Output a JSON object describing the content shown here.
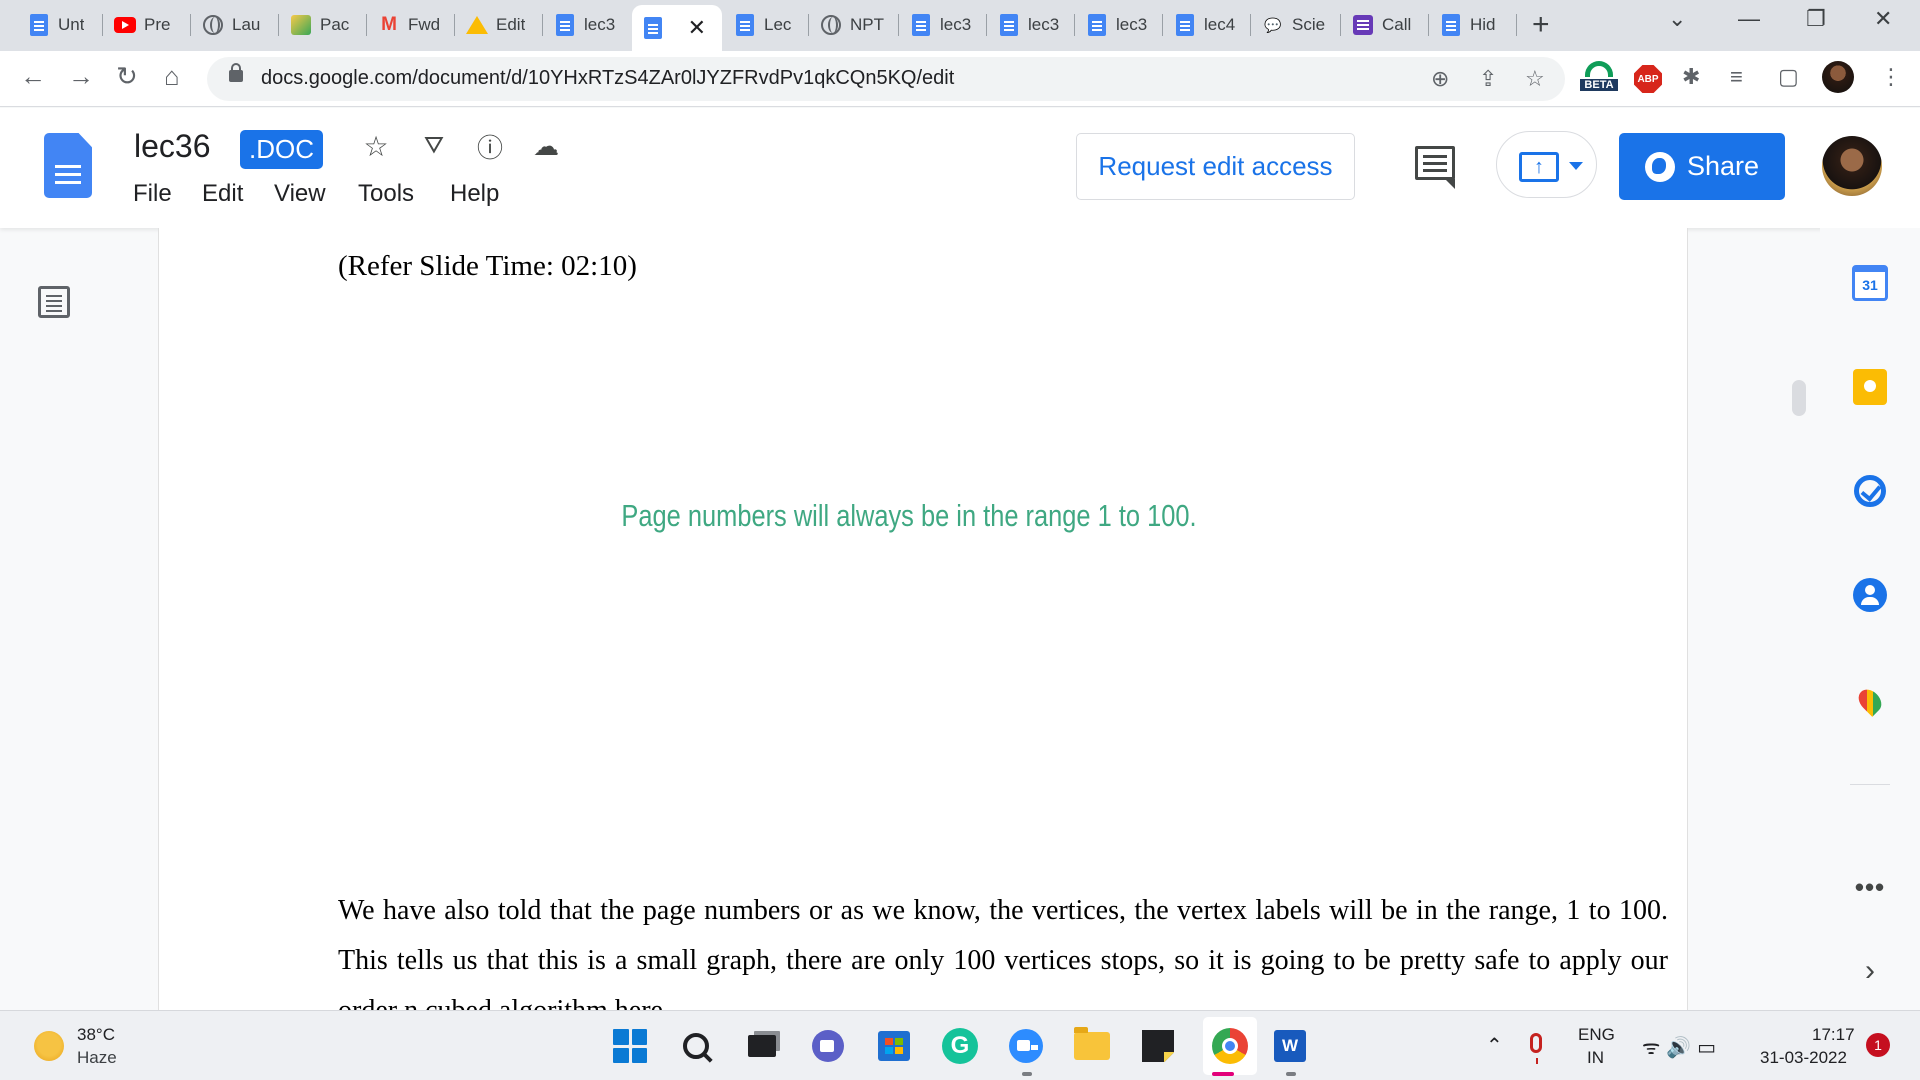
{
  "browser": {
    "tabs": [
      {
        "label": "Unt",
        "icon": "docs-icon"
      },
      {
        "label": "Pre",
        "icon": "youtube-icon"
      },
      {
        "label": "Lau",
        "icon": "globe-icon"
      },
      {
        "label": "Pac",
        "icon": "pac-icon"
      },
      {
        "label": "Fwd",
        "icon": "gmail-icon"
      },
      {
        "label": "Edit",
        "icon": "drive-icon"
      },
      {
        "label": "lec3",
        "icon": "docs-icon"
      },
      {
        "label": "",
        "icon": "docs-icon",
        "active": true
      },
      {
        "label": "Lec",
        "icon": "docs-icon"
      },
      {
        "label": "NPT",
        "icon": "globe-icon"
      },
      {
        "label": "lec3",
        "icon": "docs-icon"
      },
      {
        "label": "lec3",
        "icon": "docs-icon"
      },
      {
        "label": "lec3",
        "icon": "docs-icon"
      },
      {
        "label": "lec4",
        "icon": "docs-icon"
      },
      {
        "label": "Scie",
        "icon": "chat-icon"
      },
      {
        "label": "Call",
        "icon": "forms-icon"
      },
      {
        "label": "Hid",
        "icon": "docs-icon"
      }
    ],
    "url": "docs.google.com/document/d/10YHxRTzS4ZAr0lJYZFRvdPv1qkCQn5KQ/edit",
    "beta_label": "BETA",
    "abp_label": "ABP"
  },
  "docs": {
    "title": "lec36",
    "badge": ".DOC",
    "menu": [
      "File",
      "Edit",
      "View",
      "Tools",
      "Help"
    ],
    "request_edit_label": "Request edit access",
    "share_label": "Share"
  },
  "document": {
    "slide_time": "(Refer Slide Time: 02:10)",
    "slide_caption": "Page numbers will always be in the range 1 to 100.",
    "paragraph": "We have also told that the page numbers or as we know, the vertices, the vertex labels will be in the range, 1 to 100. This tells us that this is a small graph, there are only 100 vertices stops, so it is going to be pretty safe to apply our order n cubed algorithm here."
  },
  "sidepanel": {
    "calendar_day": "31"
  },
  "taskbar": {
    "weather_temp": "38°C",
    "weather_condition": "Haze",
    "lang_line1": "ENG",
    "lang_line2": "IN",
    "time": "17:17",
    "date": "31-03-2022",
    "notification_count": "1",
    "word_label": "W"
  }
}
